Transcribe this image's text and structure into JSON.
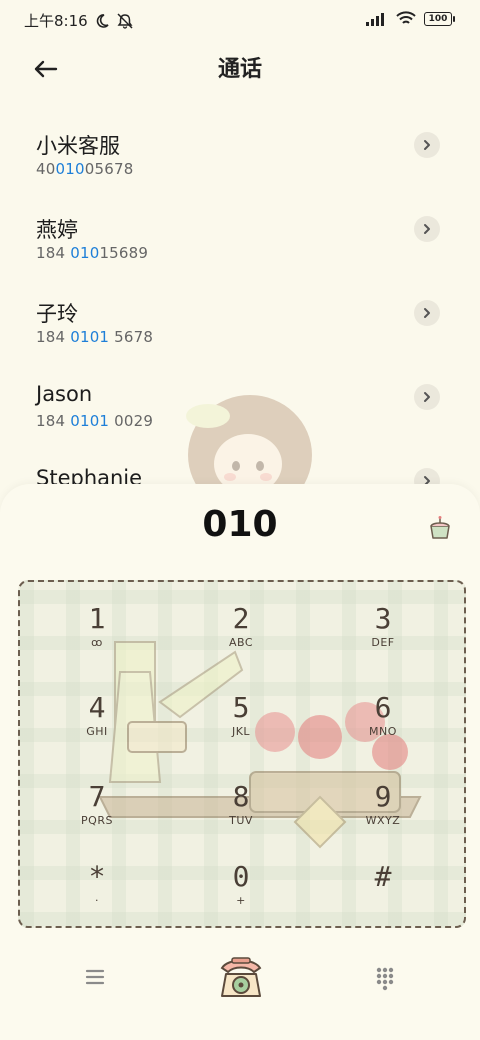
{
  "status_bar": {
    "time": "上午8:16",
    "battery": "100"
  },
  "header": {
    "title": "通话"
  },
  "contacts": [
    {
      "name": "小米客服",
      "num_prefix": "40",
      "num_match": "010",
      "num_suffix": "05678"
    },
    {
      "name": "燕婷",
      "num_prefix": "184 ",
      "num_match": "010",
      "num_suffix": "15689"
    },
    {
      "name": "子玲",
      "num_prefix": "184 ",
      "num_match": "0101",
      "num_suffix": " 5678"
    },
    {
      "name": "Jason",
      "num_prefix": "184 ",
      "num_match": "0101",
      "num_suffix": " 0029"
    },
    {
      "name": "Stephanie",
      "num_prefix": "",
      "num_match": "",
      "num_suffix": ""
    }
  ],
  "dialer": {
    "number": "010"
  },
  "keypad": [
    {
      "digit": "1",
      "letters": "ꝏ"
    },
    {
      "digit": "2",
      "letters": "ABC"
    },
    {
      "digit": "3",
      "letters": "DEF"
    },
    {
      "digit": "4",
      "letters": "GHI"
    },
    {
      "digit": "5",
      "letters": "JKL"
    },
    {
      "digit": "6",
      "letters": "MNO"
    },
    {
      "digit": "7",
      "letters": "PQRS"
    },
    {
      "digit": "8",
      "letters": "TUV"
    },
    {
      "digit": "9",
      "letters": "WXYZ"
    },
    {
      "digit": "*",
      "letters": "·"
    },
    {
      "digit": "0",
      "letters": "+"
    },
    {
      "digit": "#",
      "letters": ""
    }
  ],
  "colors": {
    "background": "#fbf9ec",
    "highlight": "#1e7fd8",
    "keypad_ink": "#4a3f36"
  },
  "icons": {
    "back": "arrow-left-icon",
    "detail": "chevron-right-icon",
    "delete": "backspace-cake-icon",
    "menu": "hamburger-menu-icon",
    "call": "rotary-phone-icon",
    "dialpad": "dialpad-grid-icon"
  }
}
